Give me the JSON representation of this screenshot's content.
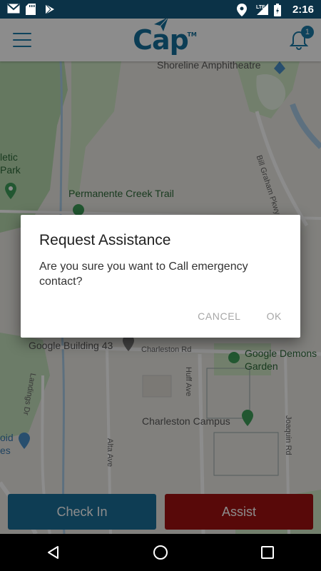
{
  "status_bar": {
    "time": "2:16",
    "network": "LTE",
    "icons": [
      "gmail-icon",
      "sd-card-icon",
      "play-store-icon",
      "location-icon",
      "signal-icon",
      "battery-icon"
    ]
  },
  "header": {
    "logo_text": "Cap",
    "logo_tm": "TM",
    "notification_count": "1"
  },
  "map": {
    "labels": {
      "shoreline": "Shoreline Amphitheatre",
      "letic": "letic",
      "park": "Park",
      "permanente": "Permanente Creek Trail",
      "bill_graham": "Bill Graham Pkwy",
      "google43": "Google Building 43",
      "charleston_rd": "Charleston Rd",
      "demons": "Google Demons",
      "garden": "Garden",
      "huff": "Huff Ave",
      "charleston_campus": "Charleston Campus",
      "landings": "Landings Dr",
      "alta": "Alta Ave",
      "joaquin": "Joaquin Rd",
      "oid": "oid",
      "es": "es"
    }
  },
  "buttons": {
    "check_in": "Check In",
    "assist": "Assist"
  },
  "dialog": {
    "title": "Request Assistance",
    "message": "Are you sure you want to Call emergency contact?",
    "cancel": "CANCEL",
    "ok": "OK"
  },
  "colors": {
    "status_bar": "#0b3247",
    "brand_blue": "#1a7aa8",
    "check_in": "#1a6f9a",
    "assist": "#a11212"
  }
}
